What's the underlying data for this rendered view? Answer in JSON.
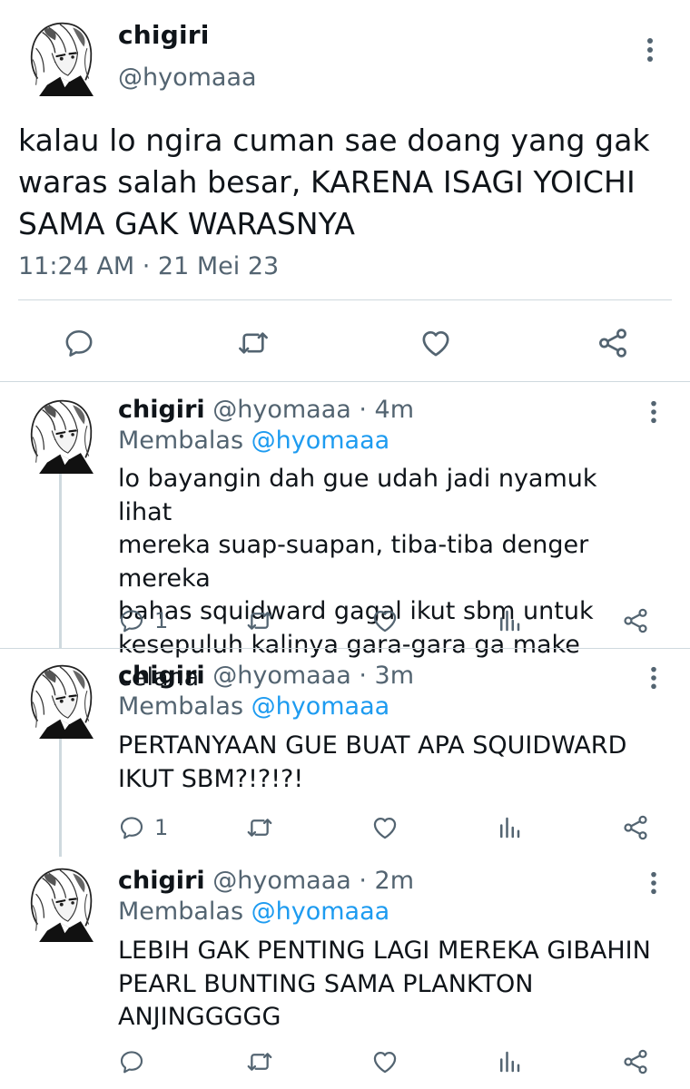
{
  "main_tweet": {
    "display_name": "chigiri",
    "handle": "@hyomaaa",
    "text": "kalau lo ngira cuman sae doang yang gak waras salah besar, KARENA ISAGI YOICHI SAMA GAK WARASNYA",
    "timestamp": "11:24 AM · 21 Mei 23",
    "actions": [
      "reply-icon",
      "retweet-icon",
      "like-icon",
      "share-icon"
    ]
  },
  "replies": [
    {
      "display_name": "chigiri",
      "meta": "@hyomaaa · 4m",
      "replying_prefix": "Membalas",
      "replying_to": "@hyomaaa",
      "text": "lo bayangin dah gue udah jadi nyamuk lihat\nmereka suap-suapan, tiba-tiba denger mereka\nbahas squidward gagal ikut sbm untuk\nkesepuluh kalinya gara-gara ga make celana",
      "reply_count": "1"
    },
    {
      "display_name": "chigiri",
      "meta": "@hyomaaa · 3m",
      "replying_prefix": "Membalas",
      "replying_to": "@hyomaaa",
      "text": "PERTANYAAN GUE BUAT APA SQUIDWARD\nIKUT SBM?!?!?!",
      "reply_count": "1"
    },
    {
      "display_name": "chigiri",
      "meta": "@hyomaaa · 2m",
      "replying_prefix": "Membalas",
      "replying_to": "@hyomaaa",
      "text": "LEBIH GAK PENTING LAGI MEREKA GIBAHIN\nPEARL BUNTING SAMA PLANKTON\nANJINGGGGG",
      "reply_count": ""
    }
  ],
  "colors": {
    "text": "#0f1419",
    "secondary": "#536471",
    "link": "#1d9bf0",
    "divider": "#cfd9de"
  }
}
